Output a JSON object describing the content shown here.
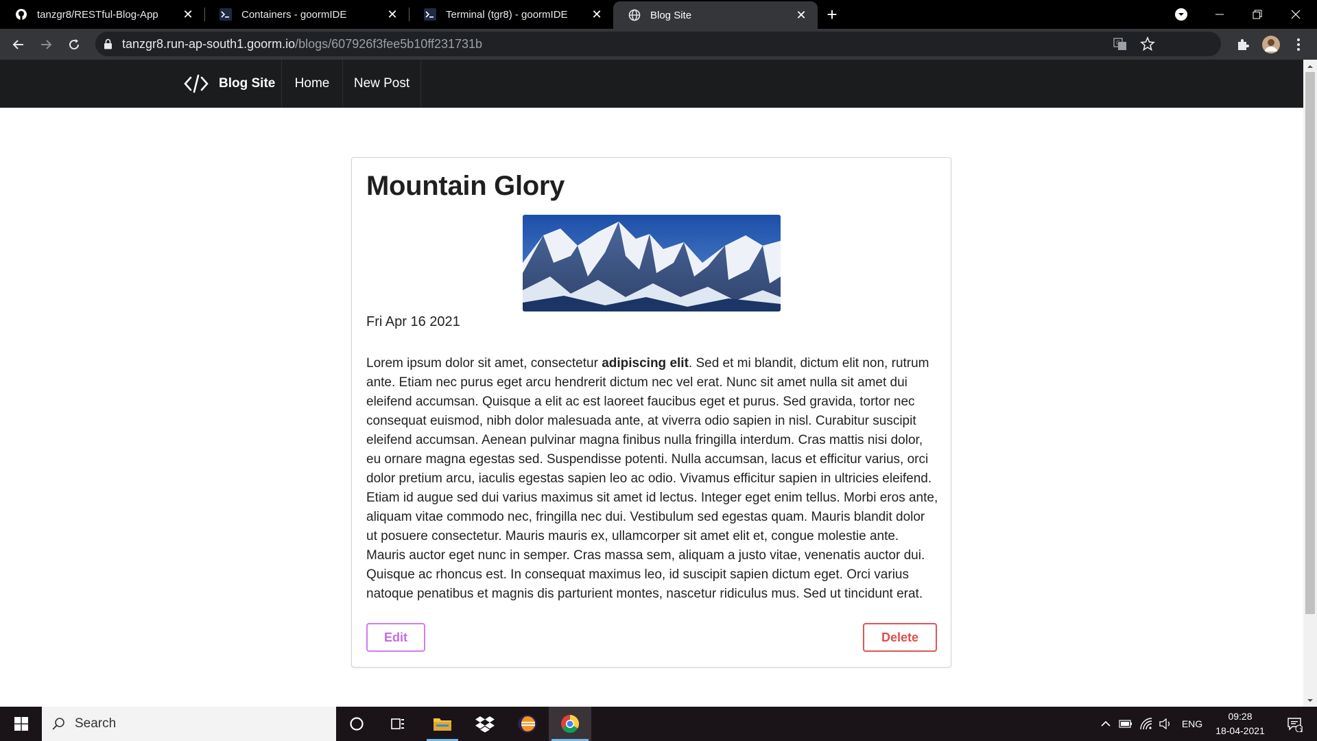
{
  "browser": {
    "tabs": [
      {
        "title": "tanzgr8/RESTful-Blog-App",
        "icon": "github-icon",
        "active": false
      },
      {
        "title": "Containers - goormIDE",
        "icon": "terminal-icon",
        "active": false
      },
      {
        "title": "Terminal (tgr8) - goormIDE",
        "icon": "terminal-icon",
        "active": false
      },
      {
        "title": "Blog Site",
        "icon": "globe-icon",
        "active": true
      }
    ],
    "url_host": "tanzgr8.run-ap-south1.goorm.io",
    "url_path": "/blogs/607926f3fee5b10ff231731b"
  },
  "site_nav": {
    "brand": "Blog Site",
    "links": [
      "Home",
      "New Post"
    ]
  },
  "post": {
    "title": "Mountain Glory",
    "date": "Fri Apr 16 2021",
    "body_before_bold": "Lorem ipsum dolor sit amet, consectetur ",
    "body_bold": "adipiscing elit",
    "body_after_bold": ". Sed et mi blandit, dictum elit non, rutrum ante. Etiam nec purus eget arcu hendrerit dictum nec vel erat. Nunc sit amet nulla sit amet dui eleifend accumsan. Quisque a elit ac est laoreet faucibus eget et purus. Sed gravida, tortor nec consequat euismod, nibh dolor malesuada ante, at viverra odio sapien in nisl. Curabitur suscipit eleifend accumsan. Aenean pulvinar magna finibus nulla fringilla interdum. Cras mattis nisi dolor, eu ornare magna egestas sed. Suspendisse potenti. Nulla accumsan, lacus et efficitur varius, orci dolor pretium arcu, iaculis egestas sapien leo ac odio. Vivamus efficitur sapien in ultricies eleifend. Etiam id augue sed dui varius maximus sit amet id lectus. Integer eget enim tellus. Morbi eros ante, aliquam vitae commodo nec, fringilla nec dui. Vestibulum sed egestas quam. Mauris blandit dolor ut posuere consectetur. Mauris mauris ex, ullamcorper sit amet elit et, congue molestie ante. Mauris auctor eget nunc in semper. Cras massa sem, aliquam a justo vitae, venenatis auctor dui. Quisque ac rhoncus est. In consequat maximus leo, id suscipit sapien dictum eget. Orci varius natoque penatibus et magnis dis parturient montes, nascetur ridiculus mus. Sed ut tincidunt erat.",
    "edit_label": "Edit",
    "delete_label": "Delete",
    "image": "mountain-landscape"
  },
  "taskbar": {
    "search_placeholder": "Search",
    "language": "ENG",
    "time": "09:28",
    "date": "18-04-2021",
    "notification_count": "1"
  },
  "colors": {
    "edit": "#c46be6",
    "delete": "#dc4f4f",
    "nav_bg": "#1b1c1d",
    "taskbar_active": "#76b9ed"
  }
}
